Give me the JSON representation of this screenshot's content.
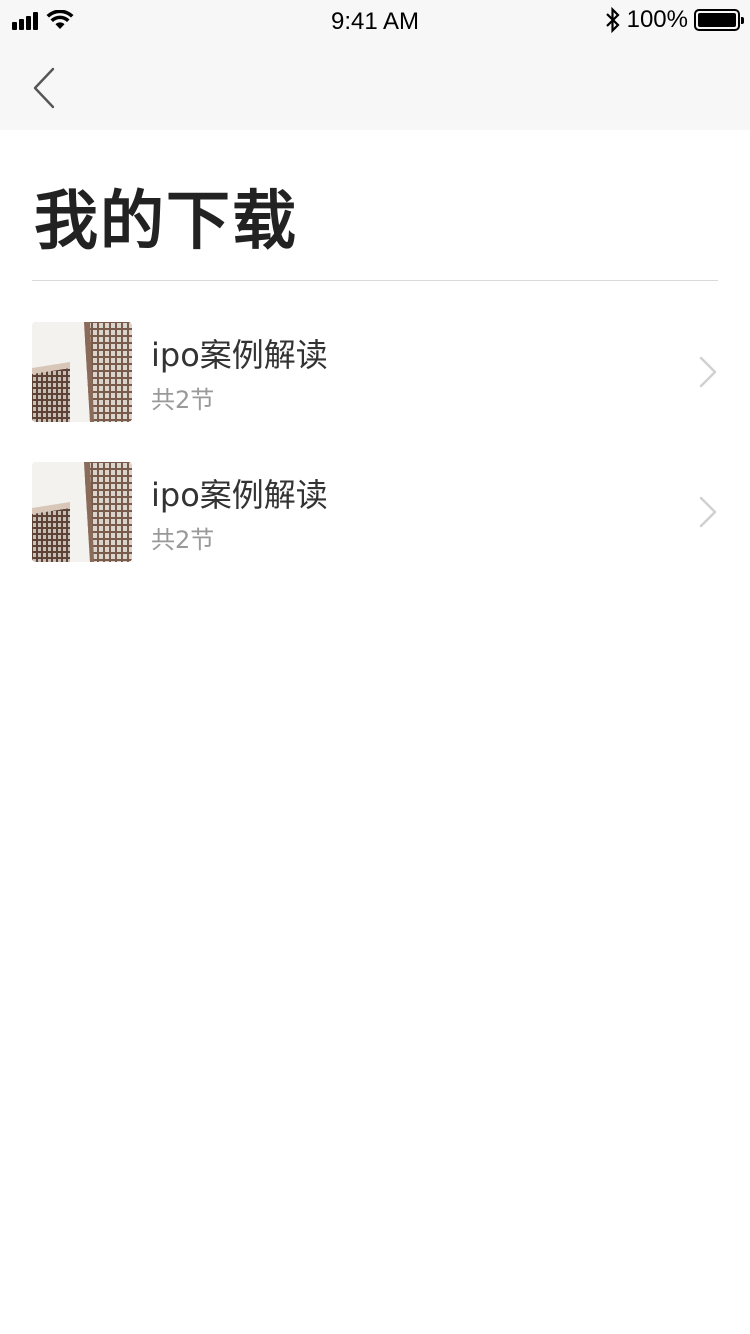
{
  "status_bar": {
    "time": "9:41 AM",
    "battery_percent": "100%",
    "icons": [
      "signal-icon",
      "wifi-icon",
      "bluetooth-icon",
      "battery-icon"
    ]
  },
  "nav": {
    "back_icon": "chevron-left-icon"
  },
  "page": {
    "title": "我的下载"
  },
  "downloads": [
    {
      "title": "ipo案例解读",
      "subtitle": "共2节",
      "thumbnail_icon": "building-facade-image",
      "chevron_icon": "chevron-right-icon"
    },
    {
      "title": "ipo案例解读",
      "subtitle": "共2节",
      "thumbnail_icon": "building-facade-image",
      "chevron_icon": "chevron-right-icon"
    }
  ],
  "colors": {
    "bar_background": "#f7f7f7",
    "title_text": "#222222",
    "item_title": "#333333",
    "item_subtitle": "#999999",
    "divider": "#d9d9d9",
    "chevron": "#d0d0d0"
  }
}
